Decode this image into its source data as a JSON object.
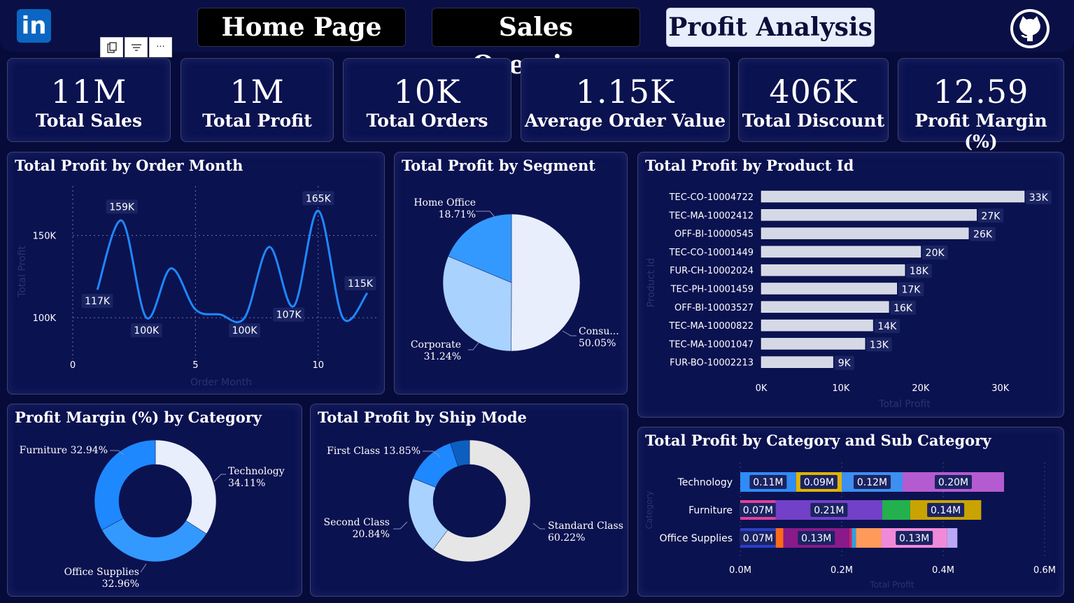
{
  "nav": {
    "logo": "in",
    "tabs": [
      "Home Page",
      "Sales Overview",
      "Profit Analysis"
    ],
    "active_tab": "Profit Analysis",
    "github_icon": "github-icon"
  },
  "toolbar": {
    "icons": [
      "copy-icon",
      "filter-icon",
      "more-options-icon"
    ],
    "more_label": "···"
  },
  "kpis": [
    {
      "value": "11M",
      "label": "Total Sales"
    },
    {
      "value": "1M",
      "label": "Total Profit"
    },
    {
      "value": "10K",
      "label": "Total Orders"
    },
    {
      "value": "1.15K",
      "label": "Average Order Value"
    },
    {
      "value": "406K",
      "label": "Total Discount"
    },
    {
      "value": "12.59",
      "label": "Profit Margin (%)"
    }
  ],
  "colors": {
    "background": "#070b3a",
    "panel": "#0b1250",
    "accent_blue": "#1e88ff",
    "light_blue": "#a9d2ff",
    "pale": "#e8eefb"
  },
  "chart_data": [
    {
      "type": "line",
      "title": "Total Profit by Order Month",
      "xlabel": "Order Month",
      "ylabel": "Total Profit",
      "x": [
        1,
        2,
        3,
        4,
        5,
        6,
        7,
        8,
        9,
        10,
        11,
        12
      ],
      "values": [
        117,
        159,
        100,
        130,
        105,
        102,
        100,
        143,
        107,
        165,
        100,
        115
      ],
      "data_labels": [
        {
          "x": 1,
          "text": "117K"
        },
        {
          "x": 2,
          "text": "159K"
        },
        {
          "x": 3,
          "text": "100K"
        },
        {
          "x": 7,
          "text": "100K"
        },
        {
          "x": 9,
          "text": "107K"
        },
        {
          "x": 10,
          "text": "165K"
        },
        {
          "x": 12,
          "text": "115K"
        }
      ],
      "x_ticks": [
        "0",
        "5",
        "10"
      ],
      "y_ticks": [
        "100K",
        "150K"
      ],
      "xlim": [
        0,
        12.4
      ],
      "ylim": [
        75,
        180
      ],
      "grid": true
    },
    {
      "type": "pie",
      "title": "Total Profit by Segment",
      "slices": [
        {
          "label": "Consu...",
          "percent": "50.05%",
          "value": 50.05,
          "color": "#e8eefb"
        },
        {
          "label": "Corporate",
          "percent": "31.24%",
          "value": 31.24,
          "color": "#a9d2ff"
        },
        {
          "label": "Home Office",
          "percent": "18.71%",
          "value": 18.71,
          "color": "#3399ff"
        }
      ]
    },
    {
      "type": "bar",
      "orientation": "horizontal",
      "title": "Total Profit by Product Id",
      "xlabel": "Total Profit",
      "ylabel": "Product Id",
      "categories": [
        "TEC-CO-10004722",
        "TEC-MA-10002412",
        "OFF-BI-10000545",
        "TEC-CO-10001449",
        "FUR-CH-10002024",
        "TEC-PH-10001459",
        "OFF-BI-10003527",
        "TEC-MA-10000822",
        "TEC-MA-10001047",
        "FUR-BO-10002213"
      ],
      "values": [
        33,
        27,
        26,
        20,
        18,
        17,
        16,
        14,
        13,
        9
      ],
      "data_labels": [
        "33K",
        "27K",
        "26K",
        "20K",
        "18K",
        "17K",
        "16K",
        "14K",
        "13K",
        "9K"
      ],
      "x_ticks": [
        "0K",
        "10K",
        "20K",
        "30K"
      ],
      "xlim": [
        0,
        33
      ],
      "color": "#d5d9e6"
    },
    {
      "type": "pie",
      "variant": "donut",
      "title": "Profit Margin (%) by Category",
      "slices": [
        {
          "label": "Technology",
          "percent": "34.11%",
          "value": 34.11,
          "color": "#e8eefb"
        },
        {
          "label": "Office Supplies",
          "percent": "32.96%",
          "value": 32.96,
          "color": "#3399ff"
        },
        {
          "label": "Furniture",
          "percent": "32.94%",
          "value": 32.94,
          "color": "#1e88ff"
        }
      ]
    },
    {
      "type": "pie",
      "variant": "donut",
      "title": "Total Profit by Ship Mode",
      "slices": [
        {
          "label": "Standard Class",
          "percent": "60.22%",
          "value": 60.22,
          "color": "#e6e6e6"
        },
        {
          "label": "Second Class",
          "percent": "20.84%",
          "value": 20.84,
          "color": "#a9d2ff"
        },
        {
          "label": "First Class",
          "percent": "13.85%",
          "value": 13.85,
          "color": "#1e88ff"
        },
        {
          "label": "",
          "percent": "",
          "value": 5.09,
          "color": "#0d5fbf"
        }
      ]
    },
    {
      "type": "bar",
      "orientation": "horizontal",
      "stacked": true,
      "title": "Total Profit by Category and Sub Category",
      "xlabel": "Total Profit",
      "ylabel": "Category",
      "categories": [
        "Technology",
        "Furniture",
        "Office Supplies"
      ],
      "x_ticks": [
        "0.0M",
        "0.2M",
        "0.4M",
        "0.6M"
      ],
      "xlim": [
        0,
        0.6
      ],
      "rows": [
        [
          {
            "value": 0.11,
            "label": "0.11M",
            "color": "#2f8cf5"
          },
          {
            "value": 0.09,
            "label": "0.09M",
            "color": "#e0b400"
          },
          {
            "value": 0.12,
            "label": "0.12M",
            "color": "#3d8ff0"
          },
          {
            "value": 0.2,
            "label": "0.20M",
            "color": "#b55bd0"
          }
        ],
        [
          {
            "value": 0.07,
            "label": "0.07M",
            "color": "#e0409a"
          },
          {
            "value": 0.21,
            "label": "0.21M",
            "color": "#7340c8"
          },
          {
            "value": 0.055,
            "label": "",
            "color": "#22b14c"
          },
          {
            "value": 0.14,
            "label": "0.14M",
            "color": "#c9a400"
          }
        ],
        [
          {
            "value": 0.07,
            "label": "0.07M",
            "color": "#2b3ec9"
          },
          {
            "value": 0.015,
            "label": "",
            "color": "#ff6a1a"
          },
          {
            "value": 0.13,
            "label": "0.13M",
            "color": "#8a1a8a"
          },
          {
            "value": 0.005,
            "label": "",
            "color": "#d02060"
          },
          {
            "value": 0.008,
            "label": "",
            "color": "#29a3e0"
          },
          {
            "value": 0.05,
            "label": "",
            "color": "#ff9a5a"
          },
          {
            "value": 0.13,
            "label": "0.13M",
            "color": "#f08ad8"
          },
          {
            "value": 0.02,
            "label": "",
            "color": "#b9a8f5"
          }
        ]
      ]
    }
  ]
}
